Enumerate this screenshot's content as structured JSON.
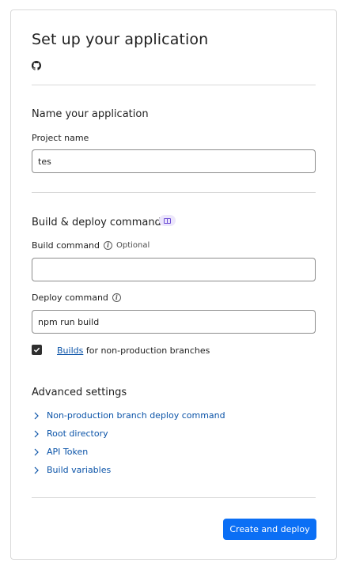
{
  "page": {
    "title": "Set up your application"
  },
  "name_section": {
    "title": "Name your application",
    "project_name_label": "Project name",
    "project_name_value": "tes"
  },
  "build_section": {
    "title": "Build & deploy commands",
    "badge_icon": "book-icon",
    "build_command_label": "Build command",
    "build_command_optional": "Optional",
    "build_command_value": "",
    "deploy_command_label": "Deploy command",
    "deploy_command_value": "npm run build",
    "builds_checkbox_checked": true,
    "builds_link_text": "Builds",
    "builds_rest_text": " for non-production branches"
  },
  "advanced": {
    "title": "Advanced settings",
    "items": [
      {
        "label": "Non-production branch deploy command"
      },
      {
        "label": "Root directory"
      },
      {
        "label": "API Token"
      },
      {
        "label": "Build variables"
      }
    ]
  },
  "actions": {
    "create_label": "Create and deploy"
  },
  "colors": {
    "accent": "#0b6ff5",
    "link": "#0a53a8",
    "badge_bg": "#ece6fb",
    "badge_icon": "#6c4ed6"
  }
}
